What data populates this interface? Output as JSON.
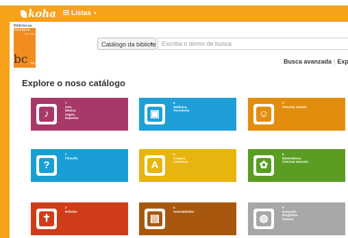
{
  "header": {
    "brand": "koha",
    "lists_menu_label": "Listas"
  },
  "logo": {
    "line1": "Bibliotecas",
    "line2": "escolares",
    "line3": "de Galicia",
    "mark": "bc",
    "mark_sub": "ba"
  },
  "search": {
    "catalog_select_value": "Catálogo da bibliotec",
    "input_placeholder": "Escriba o termo de busca",
    "advanced_link": "Busca avanzada",
    "explore_link": "Explora"
  },
  "main": {
    "heading": "Explore o noso catálogo",
    "tiles": [
      {
        "number": "7",
        "label": "Arte.\nMúsica.\nXogos.\nDeportes",
        "color": "#a8386a",
        "icon": "art-icon"
      },
      {
        "number": "6",
        "label": "Medicina.\nTecnoloxía",
        "color": "#1f9fd8",
        "icon": "robot-icon"
      },
      {
        "number": "3",
        "label": "Ciencias Sociais",
        "color": "#e38d0e",
        "icon": "people-icon"
      },
      {
        "number": "1",
        "label": "Filosofía",
        "color": "#1a9ed6",
        "icon": "thinker-icon"
      },
      {
        "number": "8",
        "label": "Linguas.\nLiteratura",
        "color": "#e8b40e",
        "icon": "letter-icon"
      },
      {
        "number": "5",
        "label": "Matemáticas.\nCiencias Naturais",
        "color": "#5a9d22",
        "icon": "science-icon"
      },
      {
        "number": "2",
        "label": "Relixión",
        "color": "#cf3c18",
        "icon": "religion-icon"
      },
      {
        "number": "0",
        "label": "Xeneralidades",
        "color": "#a8570f",
        "icon": "book-icon"
      },
      {
        "number": "9",
        "label": "Xeografía.\nBiografías.\nHistoria",
        "color": "#a7a7a7",
        "icon": "globe-icon"
      }
    ]
  }
}
